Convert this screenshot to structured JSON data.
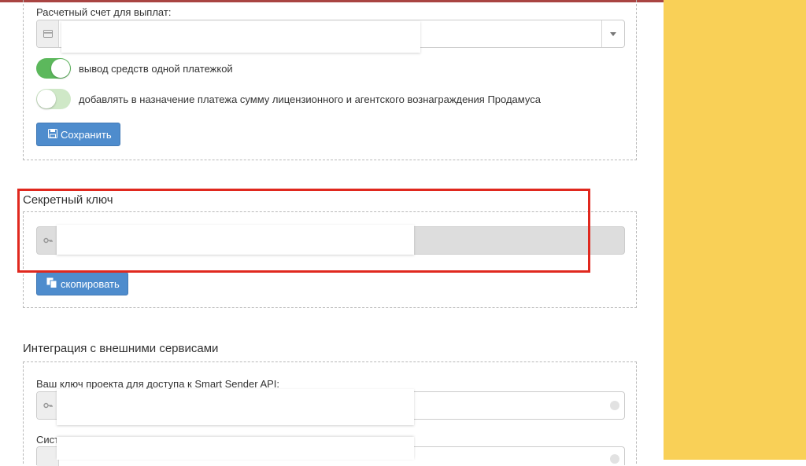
{
  "payout": {
    "account_label": "Расчетный счет для выплат:",
    "account_value": "",
    "single_payment_label": "вывод средств одной платежкой",
    "single_payment_on": true,
    "add_fee_label": "добавлять в назначение платежа сумму лицензионного и агентского вознаграждения Продамуса",
    "add_fee_on": false,
    "save_label": "Сохранить"
  },
  "secret": {
    "title": "Секретный ключ",
    "value": "",
    "copy_label": "скопировать"
  },
  "integration": {
    "title": "Интеграция с внешними сервисами",
    "smart_sender_label": "Ваш ключ проекта для доступа к Smart Sender API:",
    "smart_sender_value": "",
    "next_label_partial": "Сист"
  },
  "icons": {
    "card": "card-icon",
    "key": "key-icon",
    "save": "floppy-icon",
    "copy": "copy-icon",
    "caret": "caret-down-icon"
  },
  "colors": {
    "accent": "#4e8ccd",
    "toggle_on": "#5cb85c",
    "highlight": "#e0281e",
    "side_panel": "#f9d057"
  }
}
